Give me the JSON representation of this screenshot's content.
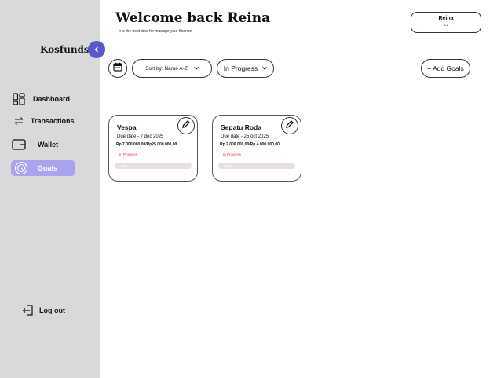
{
  "app": {
    "brand": "Kosfunds"
  },
  "sidebar": {
    "items": [
      {
        "label": "Dashboard",
        "icon": "dashboard-icon"
      },
      {
        "label": "Transactions",
        "icon": "transfer-arrows-icon"
      },
      {
        "label": "Wallet",
        "icon": "wallet-icon"
      },
      {
        "label": "Goals",
        "icon": "target-icon",
        "active": true
      }
    ],
    "logout_label": "Log out"
  },
  "header": {
    "title": "Welcome back Reina",
    "subtitle": "It is the best time for manage your finance"
  },
  "user": {
    "name": "Reina",
    "sort": "A-Z"
  },
  "toolbar": {
    "sort_label": "Sort by: Name A-Z",
    "status_label": "In Progress",
    "add_label": "+ Add Goals"
  },
  "goals": [
    {
      "title": "Vespa",
      "due": "Due date - 7 dec 2025",
      "amount": "Rp 7.000.000,00/Rp25.000.000,00",
      "status": "In Progress",
      "percent_label": "30%",
      "progress": 0.28
    },
    {
      "title": "Sepatu Roda",
      "due": "Due date - 25 oct 2025",
      "amount": "Rp 2.000.000,00/Rp 4.000.000,00",
      "status": "In Progress",
      "percent_label": "50%",
      "progress": 0.5
    }
  ],
  "colors": {
    "sidebar_bg": "#d9d9d9",
    "accent": "#5b56c9",
    "active_nav": "#a9a3f0",
    "status_text": "#e03c3c",
    "progress_track": "#e8e0e0"
  }
}
